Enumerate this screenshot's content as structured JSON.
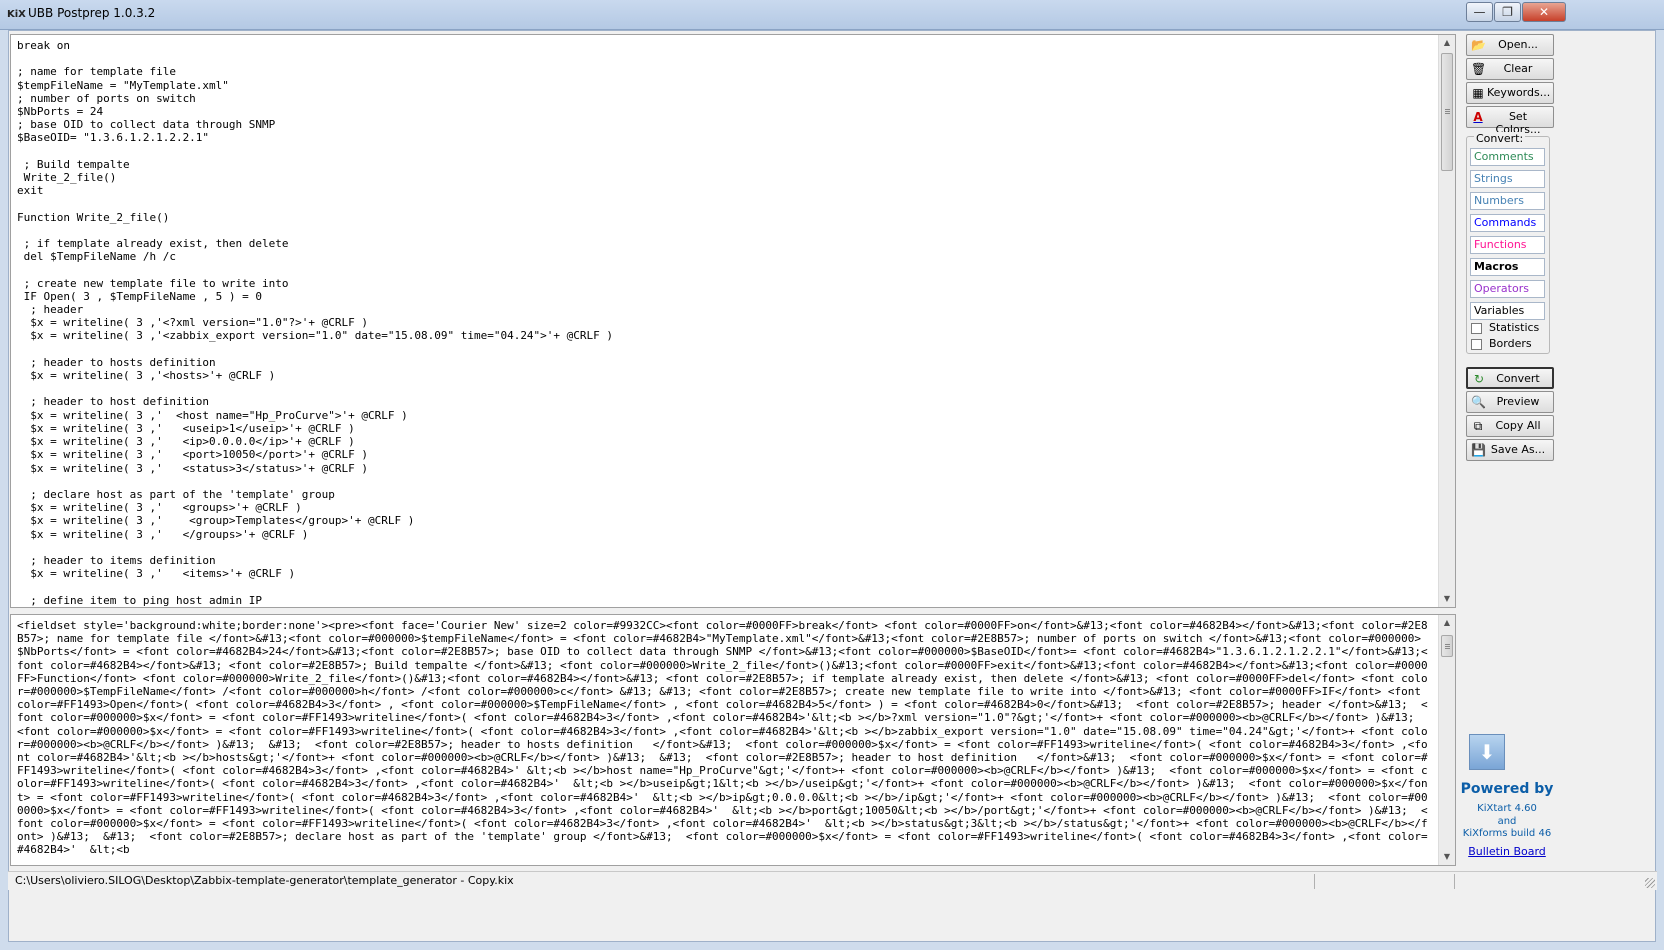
{
  "window": {
    "title": "UBB Postprep 1.0.3.2",
    "icon_text": "KiX",
    "minimize_glyph": "—",
    "maximize_glyph": "❐",
    "close_glyph": "✕"
  },
  "editor": {
    "code": "break on\n\n; name for template file\n$tempFileName = \"MyTemplate.xml\"\n; number of ports on switch\n$NbPorts = 24\n; base OID to collect data through SNMP\n$BaseOID= \"1.3.6.1.2.1.2.2.1\"\n\n ; Build tempalte\n Write_2_file()\nexit\n\nFunction Write_2_file()\n\n ; if template already exist, then delete\n del $TempFileName /h /c\n\n ; create new template file to write into\n IF Open( 3 , $TempFileName , 5 ) = 0\n  ; header\n  $x = writeline( 3 ,'<?xml version=\"1.0\"?>'+ @CRLF )\n  $x = writeline( 3 ,'<zabbix_export version=\"1.0\" date=\"15.08.09\" time=\"04.24\">'+ @CRLF )\n\n  ; header to hosts definition\n  $x = writeline( 3 ,'<hosts>'+ @CRLF )\n\n  ; header to host definition\n  $x = writeline( 3 ,'  <host name=\"Hp_ProCurve\">'+ @CRLF )\n  $x = writeline( 3 ,'   <useip>1</useip>'+ @CRLF )\n  $x = writeline( 3 ,'   <ip>0.0.0.0</ip>'+ @CRLF )\n  $x = writeline( 3 ,'   <port>10050</port>'+ @CRLF )\n  $x = writeline( 3 ,'   <status>3</status>'+ @CRLF )\n\n  ; declare host as part of the 'template' group\n  $x = writeline( 3 ,'   <groups>'+ @CRLF )\n  $x = writeline( 3 ,'    <group>Templates</group>'+ @CRLF )\n  $x = writeline( 3 ,'   </groups>'+ @CRLF )\n\n  ; header to items definition\n  $x = writeline( 3 ,'   <items>'+ @CRLF )\n\n  ; define item to ping host admin IP"
  },
  "output": {
    "html": "<fieldset style='background:white;border:none'><pre><font face='Courier New' size=2 color=#9932CC><font color=#0000FF>break</font> <font color=#0000FF>on</font>&#13;<font color=#4682B4></font>&#13;<font color=#2E8B57>; name for template file </font>&#13;<font color=#000000>$tempFileName</font> = <font color=#4682B4>\"MyTemplate.xml\"</font>&#13;<font color=#2E8B57>; number of ports on switch </font>&#13;<font color=#000000>$NbPorts</font> = <font color=#4682B4>24</font>&#13;<font color=#2E8B57>; base OID to collect data through SNMP </font>&#13;<font color=#000000>$BaseOID</font>= <font color=#4682B4>\"1.3.6.1.2.1.2.2.1\"</font>&#13;<font color=#4682B4></font>&#13; <font color=#2E8B57>; Build tempalte </font>&#13; <font color=#000000>Write_2_file</font>()&#13;<font color=#0000FF>exit</font>&#13;<font color=#4682B4></font>&#13;<font color=#0000FF>Function</font> <font color=#000000>Write_2_file</font>()&#13;<font color=#4682B4></font>&#13; <font color=#2E8B57>; if template already exist, then delete </font>&#13; <font color=#0000FF>del</font> <font color=#000000>$TempFileName</font> /<font color=#000000>h</font> /<font color=#000000>c</font> &#13; &#13; <font color=#2E8B57>; create new template file to write into </font>&#13; <font color=#0000FF>IF</font> <font color=#FF1493>Open</font>( <font color=#4682B4>3</font> , <font color=#000000>$TempFileName</font> , <font color=#4682B4>5</font> ) = <font color=#4682B4>0</font>&#13;  <font color=#2E8B57>; header </font>&#13;  <font color=#000000>$x</font> = <font color=#FF1493>writeline</font>( <font color=#4682B4>3</font> ,<font color=#4682B4>'&lt;<b ></b>?xml version=\"1.0\"?&gt;'</font>+ <font color=#000000><b>@CRLF</b></font> )&#13;  <font color=#000000>$x</font> = <font color=#FF1493>writeline</font>( <font color=#4682B4>3</font> ,<font color=#4682B4>'&lt;<b ></b>zabbix_export version=\"1.0\" date=\"15.08.09\" time=\"04.24\"&gt;'</font>+ <font color=#000000><b>@CRLF</b></font> )&#13;  &#13;  <font color=#2E8B57>; header to hosts definition   </font>&#13;  <font color=#000000>$x</font> = <font color=#FF1493>writeline</font>( <font color=#4682B4>3</font> ,<font color=#4682B4>'&lt;<b ></b>hosts&gt;'</font>+ <font color=#000000><b>@CRLF</b></font> )&#13;  &#13;  <font color=#2E8B57>; header to host definition   </font>&#13;  <font color=#000000>$x</font> = <font color=#FF1493>writeline</font>( <font color=#4682B4>3</font> ,<font color=#4682B4>' &lt;<b ></b>host name=\"Hp_ProCurve\"&gt;'</font>+ <font color=#000000><b>@CRLF</b></font> )&#13;  <font color=#000000>$x</font> = <font color=#FF1493>writeline</font>( <font color=#4682B4>3</font> ,<font color=#4682B4>'  &lt;<b ></b>useip&gt;1&lt;<b ></b>/useip&gt;'</font>+ <font color=#000000><b>@CRLF</b></font> )&#13;  <font color=#000000>$x</font> = <font color=#FF1493>writeline</font>( <font color=#4682B4>3</font> ,<font color=#4682B4>'  &lt;<b ></b>ip&gt;0.0.0.0&lt;<b ></b>/ip&gt;'</font>+ <font color=#000000><b>@CRLF</b></font> )&#13;  <font color=#000000>$x</font> = <font color=#FF1493>writeline</font>( <font color=#4682B4>3</font> ,<font color=#4682B4>'  &lt;<b ></b>port&gt;10050&lt;<b ></b>/port&gt;'</font>+ <font color=#000000><b>@CRLF</b></font> )&#13;  <font color=#000000>$x</font> = <font color=#FF1493>writeline</font>( <font color=#4682B4>3</font> ,<font color=#4682B4>'  &lt;<b ></b>status&gt;3&lt;<b ></b>/status&gt;'</font>+ <font color=#000000><b>@CRLF</b></font> )&#13;  &#13;  <font color=#2E8B57>; declare host as part of the 'template' group </font>&#13;  <font color=#000000>$x</font> = <font color=#FF1493>writeline</font>( <font color=#4682B4>3</font> ,<font color=#4682B4>'  &lt;<b"
  },
  "toolbar": {
    "open_label": "Open...",
    "clear_label": "Clear",
    "keywords_label": "Keywords...",
    "set_colors_label": "Set Colors...",
    "convert_group_label": "Convert:",
    "convert_label": "Convert",
    "preview_label": "Preview",
    "copy_all_label": "Copy All",
    "save_as_label": "Save As..."
  },
  "convert_options": [
    {
      "label": "Comments",
      "color": "#2E8B57"
    },
    {
      "label": "Strings",
      "color": "#4682B4"
    },
    {
      "label": "Numbers",
      "color": "#4682B4"
    },
    {
      "label": "Commands",
      "color": "#0000FF"
    },
    {
      "label": "Functions",
      "color": "#FF1493"
    },
    {
      "label": "Macros",
      "color": "#000000"
    },
    {
      "label": "Operators",
      "color": "#9932CC"
    },
    {
      "label": "Variables",
      "color": "#000000"
    }
  ],
  "checkboxes": {
    "statistics": "Statistics",
    "borders": "Borders"
  },
  "credits": {
    "powered_by": "Powered by",
    "kixtart": "KiXtart 4.60",
    "and": "and",
    "kixforms": "KiXforms build 46",
    "bulletin_board": "Bulletin Board"
  },
  "statusbar": {
    "path": "C:\\Users\\oliviero.SILOG\\Desktop\\Zabbix-template-generator\\template_generator - Copy.kix"
  }
}
